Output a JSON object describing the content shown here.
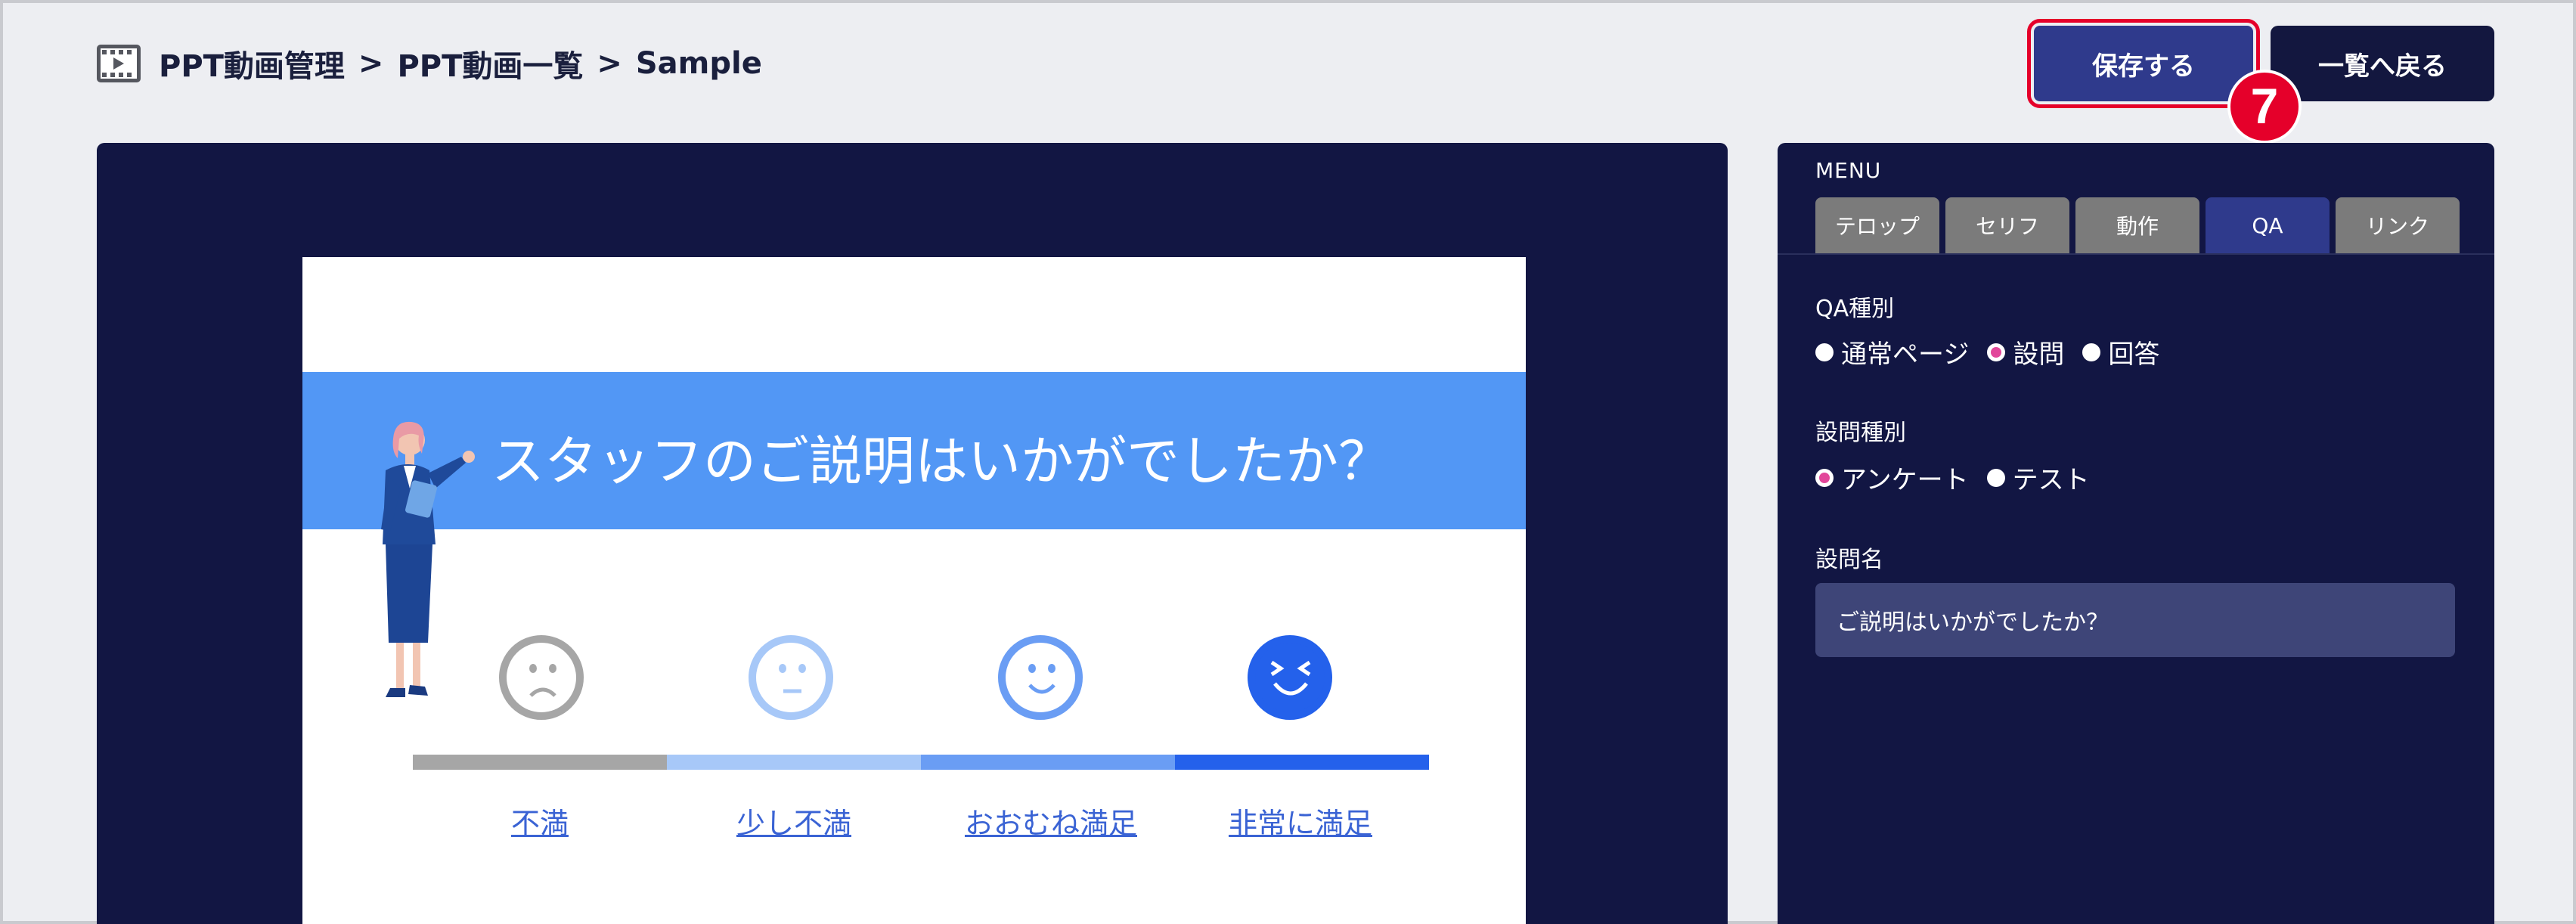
{
  "breadcrumb": {
    "icon": "film-icon",
    "items": [
      "PPT動画管理",
      "PPT動画一覧",
      "Sample"
    ],
    "separator": ">"
  },
  "header": {
    "save_label": "保存する",
    "back_label": "一覧へ戻る",
    "step_badge": "7",
    "highlight_color": "#e5002a"
  },
  "slide": {
    "title": "スタッフのご説明はいかがでしたか？",
    "options": [
      {
        "label": "不満",
        "color": "#a6a6a6",
        "face": "sad-face-icon"
      },
      {
        "label": "少し不満",
        "color": "#a7c8f8",
        "face": "neutral-face-icon"
      },
      {
        "label": "おおむね満足",
        "color": "#6a9df4",
        "face": "smile-face-icon"
      },
      {
        "label": "非常に満足",
        "color": "#2461eb",
        "face": "laugh-face-icon"
      }
    ]
  },
  "panel": {
    "menu_title": "MENU",
    "tabs": [
      {
        "label": "テロップ",
        "active": false
      },
      {
        "label": "セリフ",
        "active": false
      },
      {
        "label": "動作",
        "active": false
      },
      {
        "label": "QA",
        "active": true
      },
      {
        "label": "リンク",
        "active": false
      }
    ],
    "qa_type_label": "QA種別",
    "qa_type_options": [
      {
        "label": "通常ページ",
        "checked": false
      },
      {
        "label": "設問",
        "checked": true
      },
      {
        "label": "回答",
        "checked": false
      }
    ],
    "question_type_label": "設問種別",
    "question_type_options": [
      {
        "label": "アンケート",
        "checked": true
      },
      {
        "label": "テスト",
        "checked": false
      }
    ],
    "question_name_label": "設問名",
    "question_name_value": "ご説明はいかがでしたか？"
  }
}
